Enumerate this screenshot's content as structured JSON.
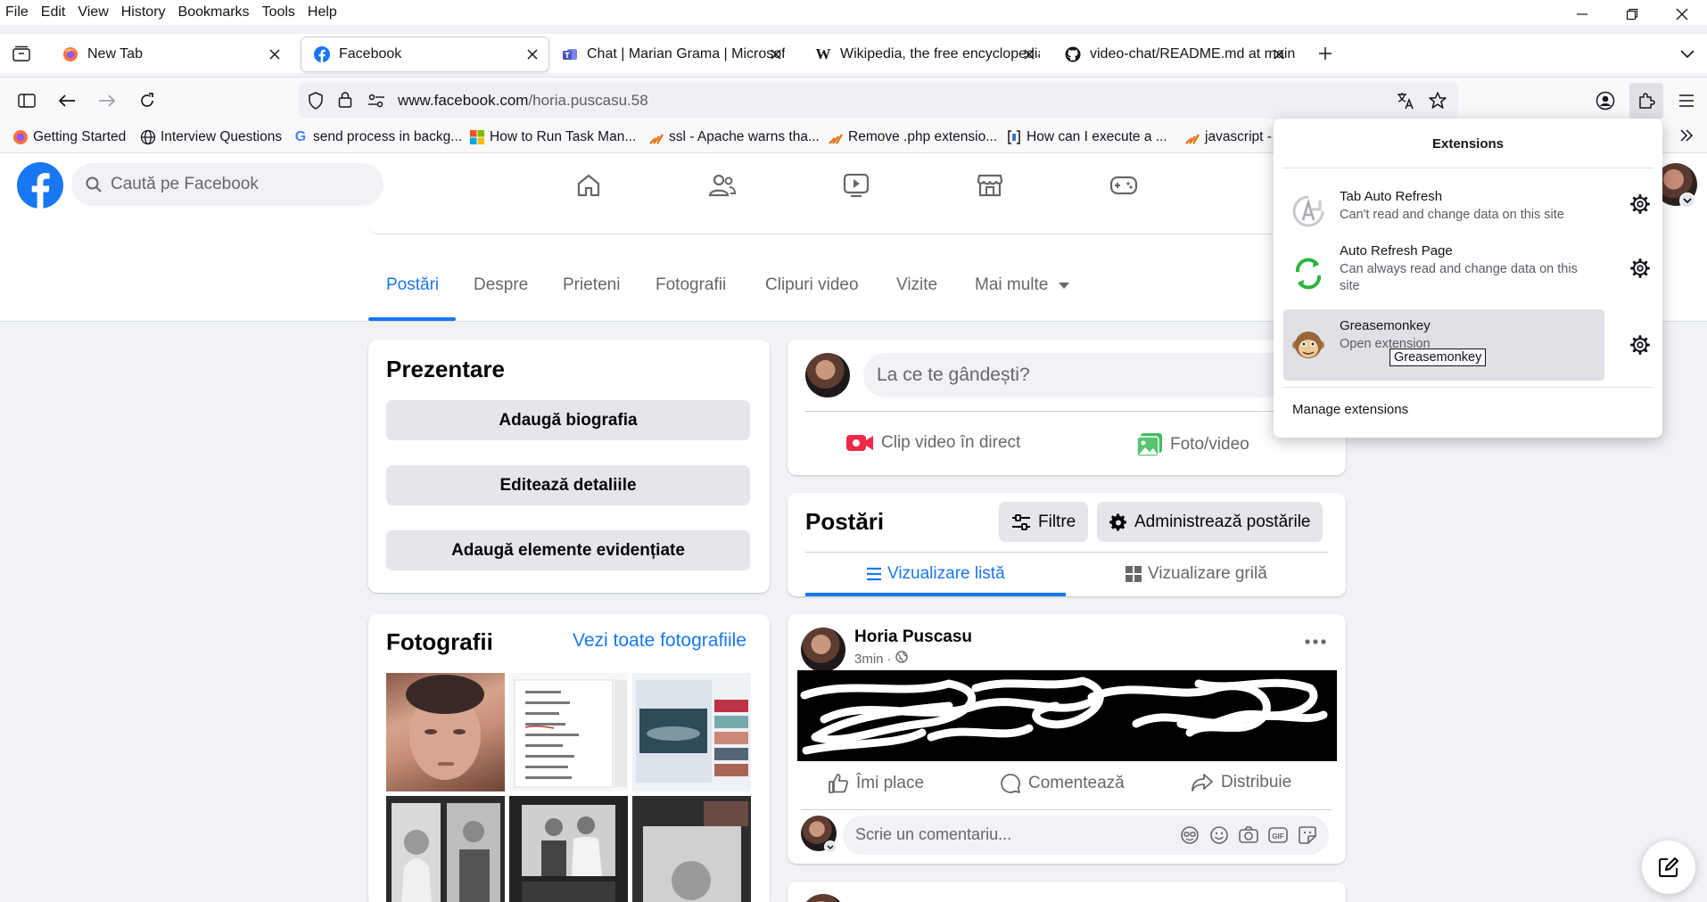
{
  "menubar": {
    "items": [
      "File",
      "Edit",
      "View",
      "History",
      "Bookmarks",
      "Tools",
      "Help"
    ]
  },
  "tabs": [
    {
      "title": "New Tab",
      "icon": "firefox-icon",
      "active": false
    },
    {
      "title": "Facebook",
      "icon": "facebook-icon",
      "active": true
    },
    {
      "title": "Chat | Marian Grama | Microsoft",
      "icon": "teams-icon",
      "active": false
    },
    {
      "title": "Wikipedia, the free encyclopedia",
      "icon": "wikipedia-icon",
      "active": false
    },
    {
      "title": "video-chat/README.md at main",
      "icon": "github-icon",
      "active": false
    }
  ],
  "urlbar": {
    "domain": "www.facebook.com",
    "path": "/horia.puscasu.58"
  },
  "bookmarks": [
    "Getting Started",
    "Interview Questions",
    "send process in backg...",
    "How to Run Task Man...",
    "ssl - Apache warns tha...",
    "Remove .php extensio...",
    "How can I execute a ...",
    "javascript -"
  ],
  "facebook": {
    "search_placeholder": "Caută pe Facebook",
    "profile_tabs": [
      "Postări",
      "Despre",
      "Prieteni",
      "Fotografii",
      "Clipuri video",
      "Vizite",
      "Mai multe"
    ],
    "intro": {
      "title": "Prezentare",
      "buttons": [
        "Adaugă biografia",
        "Editează detaliile",
        "Adaugă elemente evidențiate"
      ]
    },
    "photos": {
      "title": "Fotografii",
      "see_all": "Vezi toate fotografiile"
    },
    "composer": {
      "placeholder": "La ce te gândești?",
      "live": "Clip video în direct",
      "photo": "Foto/video"
    },
    "posts_header": {
      "title": "Postări",
      "filters": "Filtre",
      "manage": "Administrează postările",
      "list_view": "Vizualizare listă",
      "grid_view": "Vizualizare grilă"
    },
    "post": {
      "author": "Horia Puscasu",
      "time": "3min",
      "like": "Îmi place",
      "comment": "Comentează",
      "share": "Distribuie",
      "comment_placeholder": "Scrie un comentariu..."
    }
  },
  "extensions_panel": {
    "title": "Extensions",
    "items": [
      {
        "name": "Tab Auto Refresh",
        "desc": "Can't read and change data on this site"
      },
      {
        "name": "Auto Refresh Page",
        "desc": "Can always read and change data on this site"
      },
      {
        "name": "Greasemonkey",
        "desc": "Open extension"
      }
    ],
    "manage": "Manage extensions",
    "tooltip": "Greasemonkey"
  },
  "colors": {
    "fb_blue": "#1877f2",
    "chrome_bg": "#f9f9fb",
    "fb_bg": "#f0f2f5"
  }
}
